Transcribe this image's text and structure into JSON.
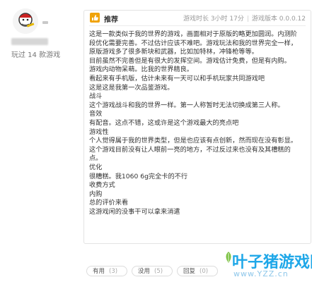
{
  "user": {
    "play_count": "玩过 14 款游戏"
  },
  "review": {
    "badge": "推荐",
    "playtime": "游戏时长 3小时 17分",
    "version": "游戏版本 0.0.0.12",
    "lines": [
      "这是一款类似于我的世界的游戏，画面相对于原版的略更加圆润。内测阶",
      "段优化需要完善。不过估计应该不难吧。游戏玩法和我的世界完全一样，",
      "原版游戏多了很多新块和武器，比如加特林，冲锋枪等等。",
      "目前虽然不完善但是有很大的发挥空间。游戏估计免费，但是有内购。",
      "游戏内动物呆萌。比我的世界精良。",
      "看起来有手机版，估计未来有一天可以和手机玩家共同游戏吧",
      "这是这是我第一次品鉴游戏。",
      "战斗",
      "这个游戏战斗和我的世界一样。第一人称暂时无法切换成第三人称。",
      "音效",
      "有配音。这点不错，这或许是这个游戏最大的亮点吧",
      "游戏性",
      "个人觉得属于我的世界类型，但是也应该有点创新，然而现在没有彰显。",
      "这个游戏目前没有让人眼前一亮的地方，不过反过来也没有及其槽糕的",
      "点。",
      "优化",
      "很糟糕。我1060 6g完全卡的不行",
      "收费方式",
      "内购",
      "总的评价来看",
      "这游戏闲的没事干可以拿来消遣"
    ]
  },
  "actions": {
    "useful_label": "有用",
    "useful_count": "(3)",
    "useless_label": "没用",
    "useless_count": "(5)",
    "reply_label": "回复",
    "reply_count": "(0)"
  },
  "watermark": {
    "main": "叶子猪游戏网",
    "sub": "www.YZZ.cn"
  },
  "colors": {
    "accent": "#1ea7e8",
    "badge": "#f0a30a"
  }
}
